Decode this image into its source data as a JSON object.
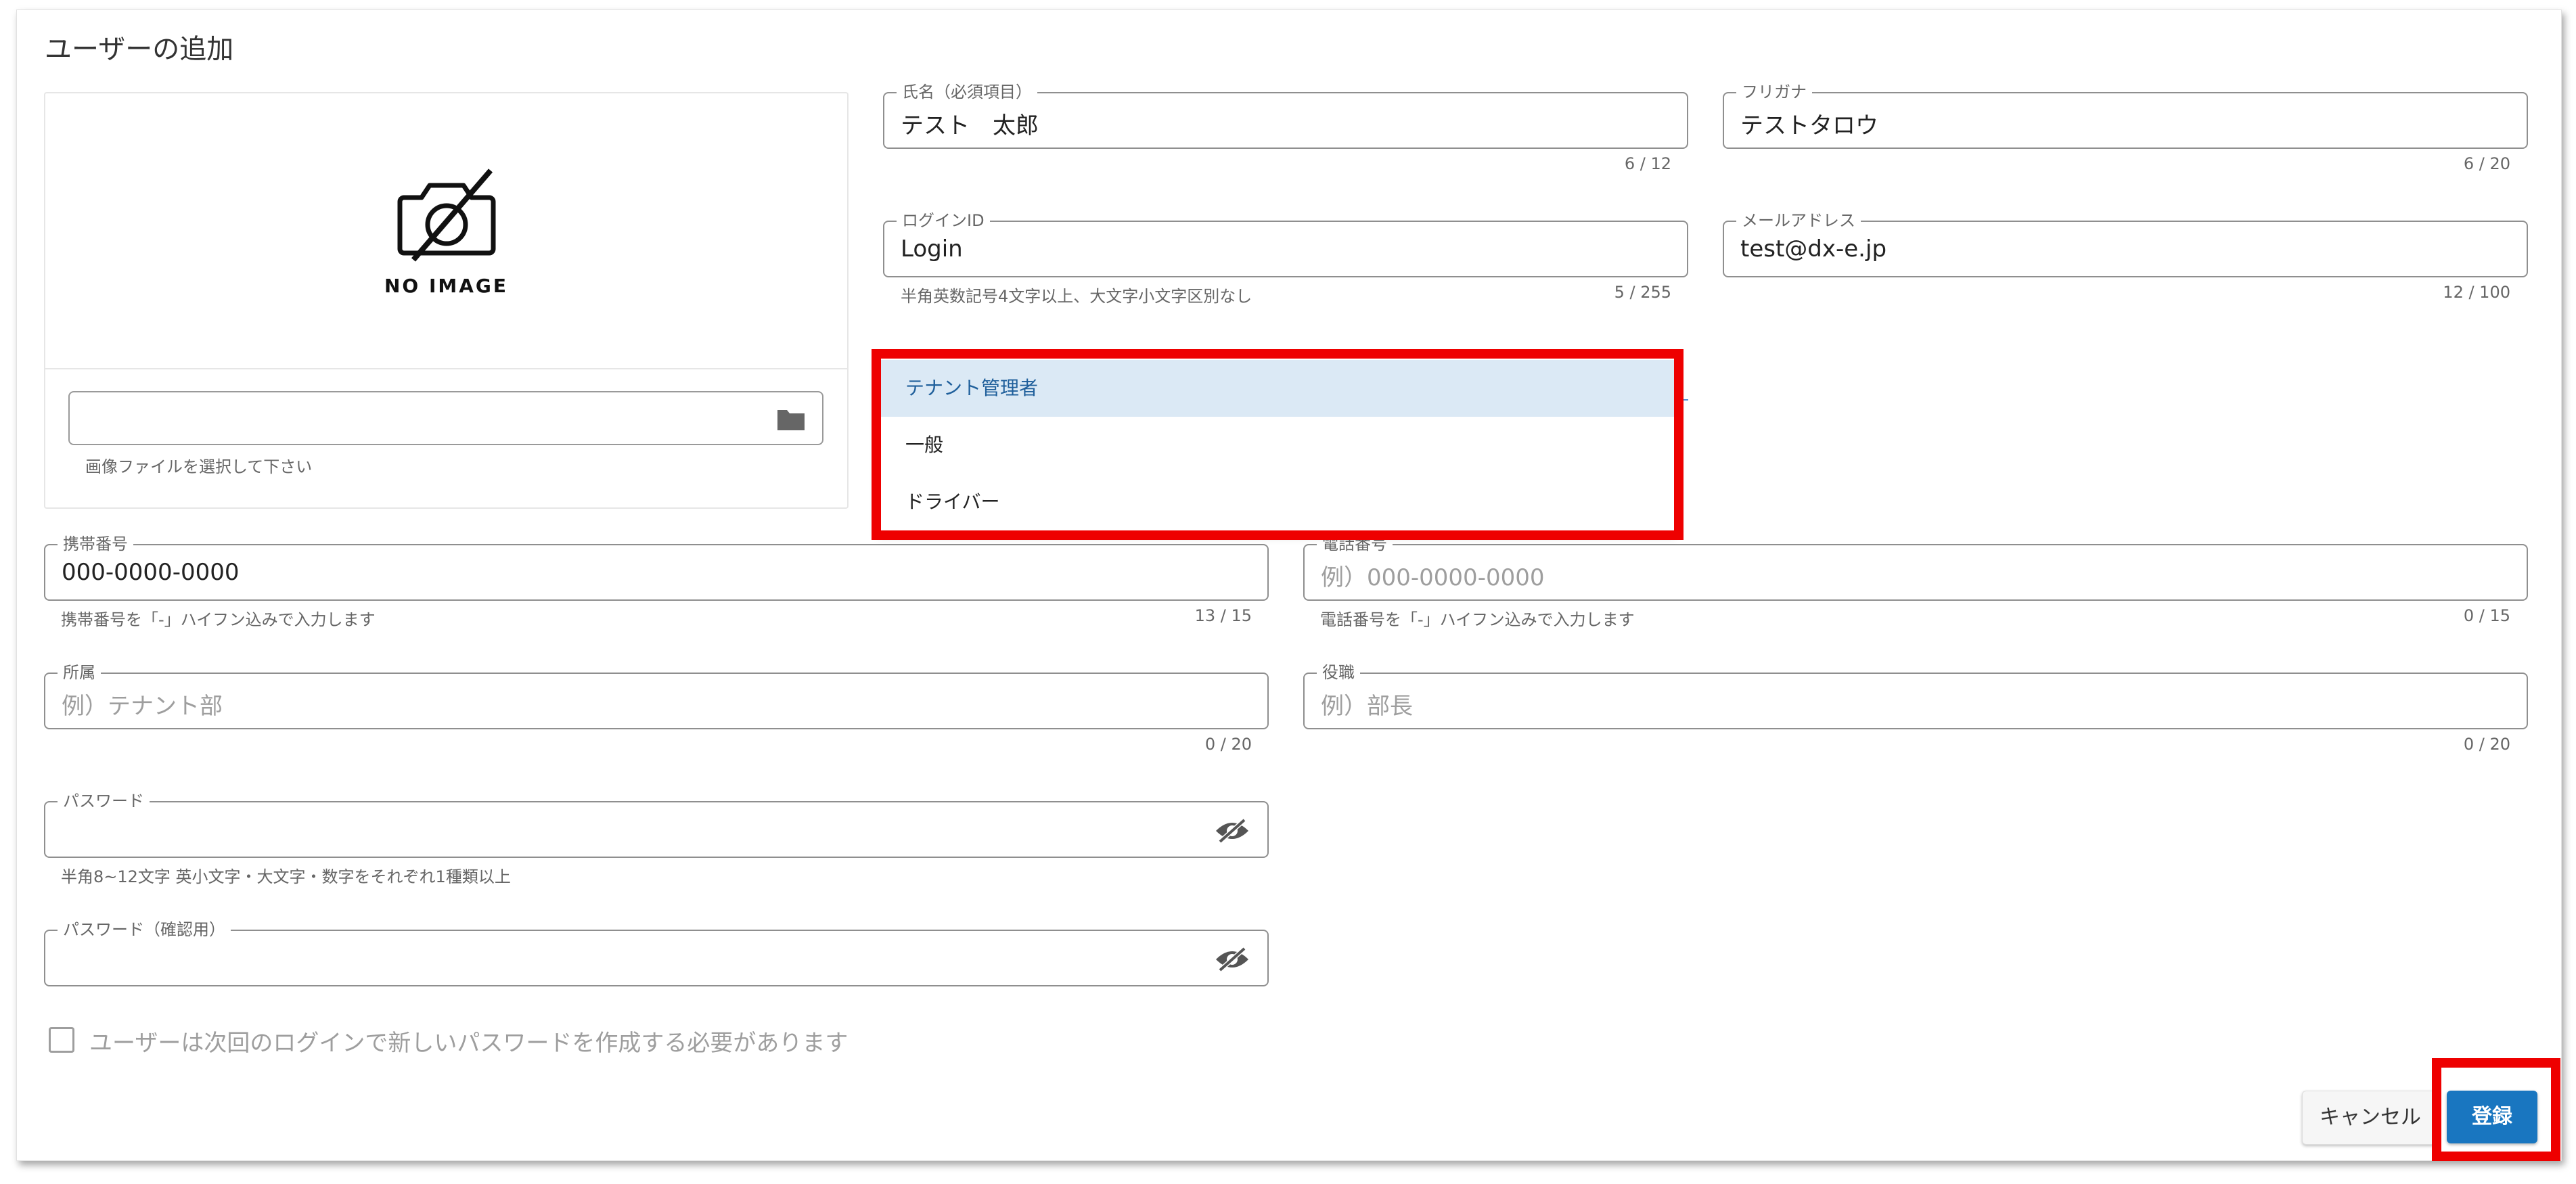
{
  "page": {
    "title": "ユーザーの追加"
  },
  "image_panel": {
    "no_image_text": "NO IMAGE",
    "file_hint": "画像ファイルを選択して下さい"
  },
  "fields": {
    "name": {
      "label": "氏名（必須項目）",
      "value": "テスト　太郎",
      "count": "6 / 12"
    },
    "furigana": {
      "label": "フリガナ",
      "value": "テストタロウ",
      "count": "6 / 20"
    },
    "login_id": {
      "label": "ログインID",
      "value": "Login",
      "hint": "半角英数記号4文字以上、大文字小文字区別なし",
      "count": "5 / 255"
    },
    "email": {
      "label": "メールアドレス",
      "value": "test@dx-e.jp",
      "count": "12 / 100"
    },
    "mobile": {
      "label": "携帯番号",
      "value": "000-0000-0000",
      "hint": "携帯番号を「-」ハイフン込みで入力します",
      "count": "13 / 15"
    },
    "phone": {
      "label": "電話番号",
      "placeholder": "例）000-0000-0000",
      "hint": "電話番号を「-」ハイフン込みで入力します",
      "count": "0 / 15"
    },
    "department": {
      "label": "所属",
      "placeholder": "例）テナント部",
      "count": "0 / 20"
    },
    "position": {
      "label": "役職",
      "placeholder": "例）部長",
      "count": "0 / 20"
    },
    "password": {
      "label": "パスワード",
      "hint": "半角8~12文字 英小文字・大文字・数字をそれぞれ1種類以上"
    },
    "password_confirm": {
      "label": "パスワード（確認用）"
    }
  },
  "role_dropdown": {
    "options": [
      "テナント管理者",
      "一般",
      "ドライバー"
    ],
    "selected_index": 0
  },
  "checkbox": {
    "label": "ユーザーは次回のログインで新しいパスワードを作成する必要があります",
    "checked": false
  },
  "buttons": {
    "cancel": "キャンセル",
    "submit": "登録"
  },
  "colors": {
    "highlight": "#ee0000",
    "primary": "#1976c0",
    "selected_bg": "#dbe9f5"
  },
  "icons": [
    "camera-off-icon",
    "folder-icon",
    "eye-off-icon"
  ]
}
